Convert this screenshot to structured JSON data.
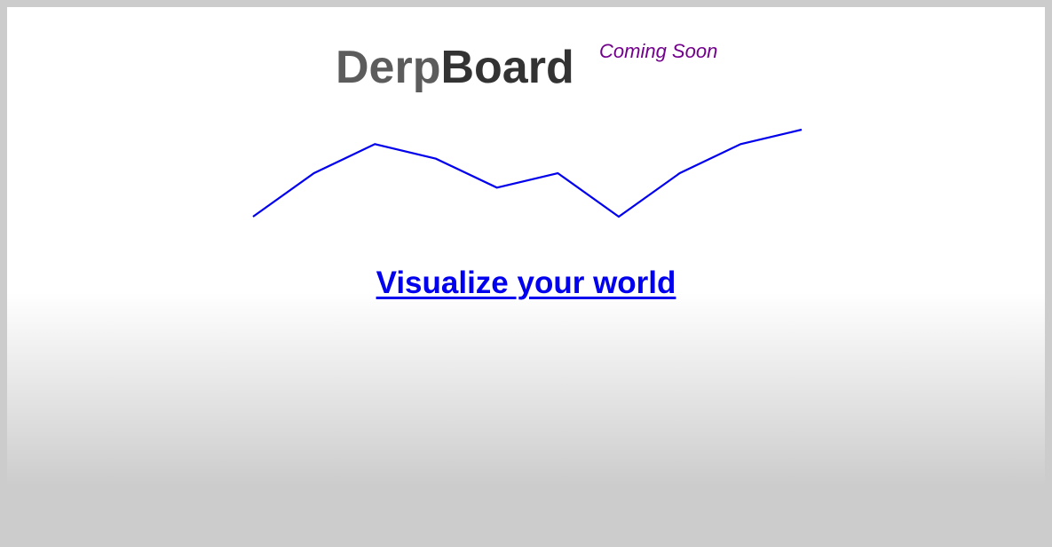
{
  "header": {
    "logo_part1": "Derp",
    "logo_part2": "Board",
    "badge": "Coming Soon"
  },
  "colors": {
    "logo_part1": "#5c5c5c",
    "logo_part2": "#333333",
    "badge": "#72008c",
    "sparkline": "#0000ee",
    "link": "#0000ee",
    "frame": "#cccccc"
  },
  "chart_data": {
    "type": "line",
    "x": [
      1,
      2,
      3,
      4,
      5,
      6,
      7,
      8,
      9,
      10
    ],
    "series": [
      {
        "values": [
          1,
          4,
          6,
          5,
          3,
          4,
          1,
          4,
          6,
          7
        ]
      }
    ],
    "ylim": [
      1,
      7
    ],
    "grid": false
  },
  "tagline": {
    "link_text": "Visualize your world"
  }
}
